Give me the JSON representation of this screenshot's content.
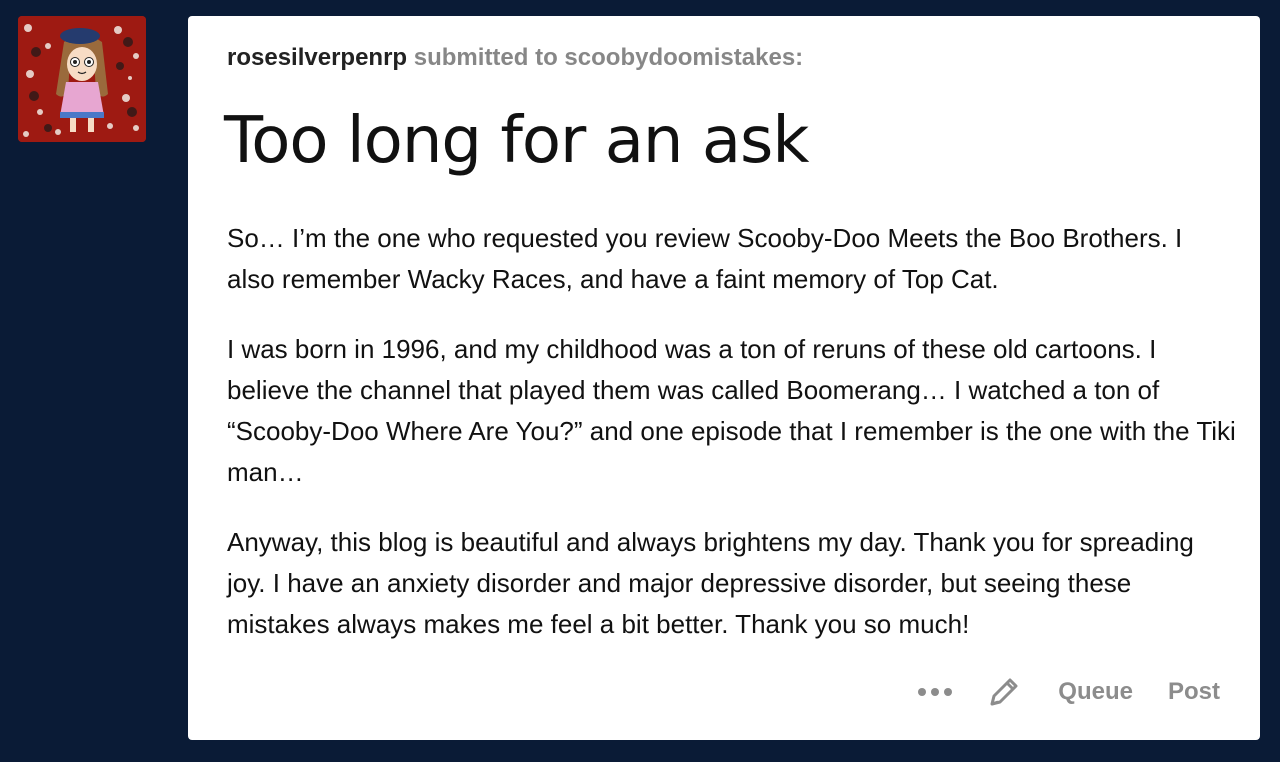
{
  "post": {
    "username": "rosesilverpenrp",
    "submitted_text": "submitted to scoobydoomistakes:",
    "title": "Too long for an ask",
    "paragraphs": [
      "So… I’m the one who requested you review Scooby-Doo Meets the Boo Brothers. I also remember Wacky Races, and have a faint memory of Top Cat.",
      "I was born in 1996, and my childhood was a ton of reruns of these old cartoons. I believe the channel that played them was called Boomerang… I watched a ton of “Scooby-Doo Where Are You?” and one episode that I remember is the one with the Tiki man…",
      "Anyway, this blog is beautiful and always brightens my day. Thank you for spreading joy. I have an anxiety disorder and major depressive disorder, but seeing these mistakes always makes me feel a bit better. Thank you so much!"
    ]
  },
  "actions": {
    "more_icon": "ellipsis-icon",
    "edit_icon": "pencil-icon",
    "queue_label": "Queue",
    "post_label": "Post"
  },
  "colors": {
    "background": "#0a1b36",
    "card": "#ffffff",
    "muted": "#878787",
    "avatar_bg": "#9e1a12"
  }
}
